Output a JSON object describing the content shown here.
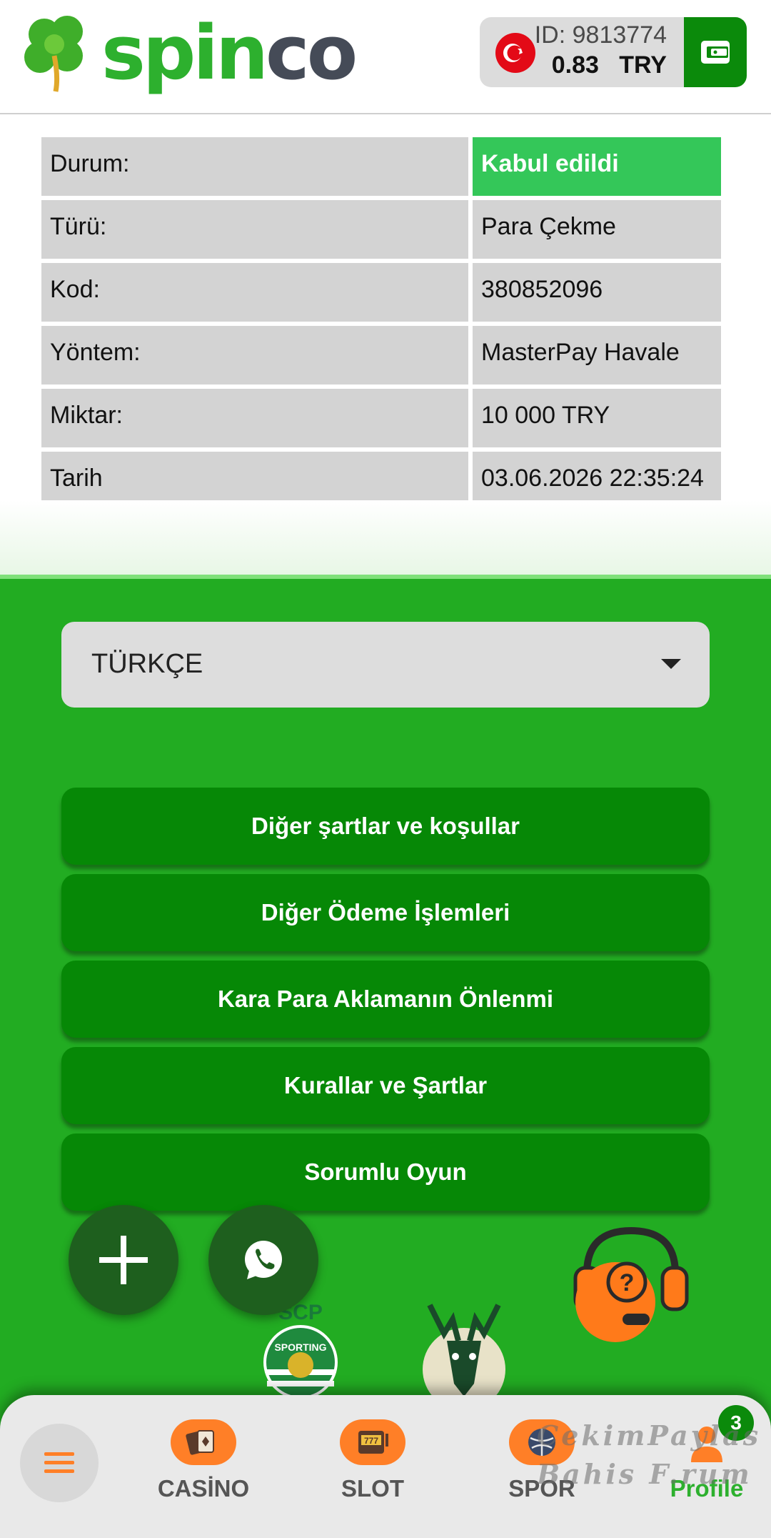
{
  "header": {
    "brand_part1": "spin",
    "brand_part2": "co",
    "user_id": "ID: 9813774",
    "balance": "0.83   TRY",
    "flag_icon": "turkey-flag-icon",
    "wallet_icon": "wallet-icon"
  },
  "details": {
    "rows": [
      {
        "label": "Durum:",
        "value": "Kabul edildi"
      },
      {
        "label": "Türü:",
        "value": "Para Çekme"
      },
      {
        "label": "Kod:",
        "value": "380852096"
      },
      {
        "label": "Yöntem:",
        "value": "MasterPay Havale"
      },
      {
        "label": "Miktar:",
        "value": "10 000 TRY"
      },
      {
        "label": "Tarih",
        "value": "03.06.2026 22:35:24"
      }
    ]
  },
  "footer": {
    "language": "TÜRKÇE",
    "links": [
      "Diğer şartlar ve koşullar",
      "Diğer Ödeme İşlemleri",
      "Kara Para Aklamanın Önlenmi",
      "Kurallar ve Şartlar",
      "Sorumlu Oyun"
    ],
    "sponsor_text": "SCP",
    "sponsor_text2": "SPORTING"
  },
  "bottom_nav": {
    "items": [
      {
        "label": "CASİNO",
        "icon": "cards-icon"
      },
      {
        "label": "SLOT",
        "icon": "slot-machine-icon"
      },
      {
        "label": "SPOR",
        "icon": "ball-icon"
      },
      {
        "label": "Profile",
        "icon": "profile-icon"
      }
    ],
    "badge": "3"
  },
  "watermark": {
    "line1": "CekimPaylas",
    "line2": "Bahis F.rum"
  },
  "colors": {
    "brand_green": "#2db02e",
    "dark_green": "#068806",
    "status_green": "#34c759",
    "accent_orange": "#ff7f27"
  }
}
